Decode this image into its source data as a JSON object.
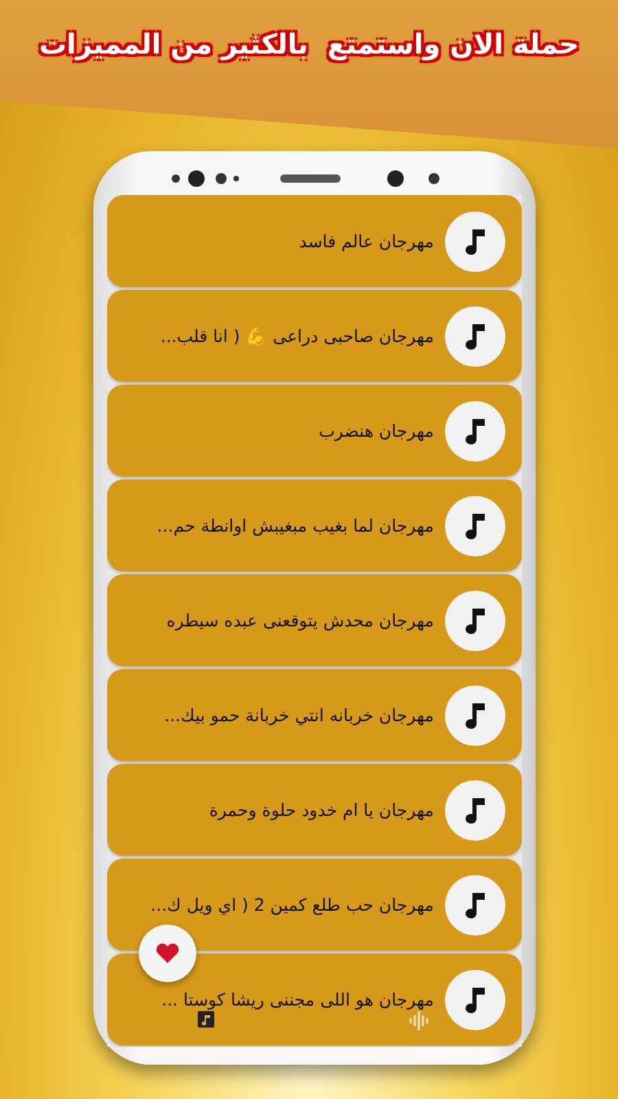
{
  "banner": {
    "title": "حملة الان واستمتع  بالكثير من المميزات"
  },
  "songs": [
    {
      "title": "مهرجان عالم فاسد"
    },
    {
      "title": "مهرجان صاحبى دراعى 💪 ( انا قلب..."
    },
    {
      "title": "مهرجان هنضرب"
    },
    {
      "title": "مهرجان لما بغيب مبغيبش اوانطة حم..."
    },
    {
      "title": "مهرجان محدش يتوقعنى عبده سيطره"
    },
    {
      "title": "مهرجان خربانه انتي خربانة حمو بيك..."
    },
    {
      "title": "مهرجان يا ام خدود حلوة وحمرة"
    },
    {
      "title": "مهرجان حب طلع كمين 2 ( اي ويل ك..."
    },
    {
      "title": "مهرجان هو اللى مجننى ريشا كوستا ..."
    }
  ]
}
